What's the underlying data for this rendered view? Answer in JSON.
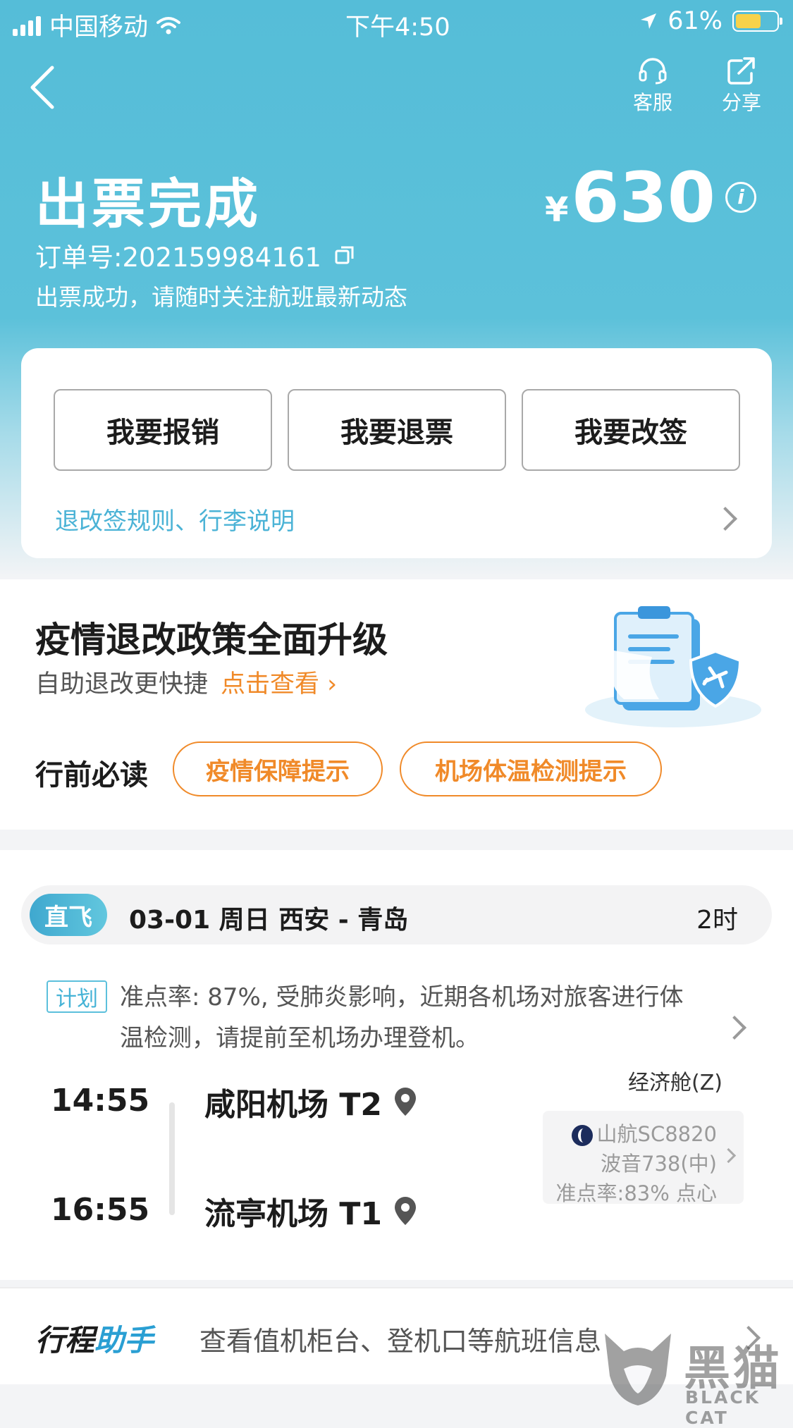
{
  "status_bar": {
    "carrier": "中国移动",
    "time": "下午4:50",
    "battery": "61%",
    "battery_level": 0.61
  },
  "nav": {
    "service_label": "客服",
    "share_label": "分享"
  },
  "header": {
    "title": "出票完成",
    "currency": "¥",
    "price": "630",
    "order_number": "订单号:202159984161",
    "message": "出票成功，请随时关注航班最新动态"
  },
  "actions": {
    "reimburse": "我要报销",
    "refund": "我要退票",
    "change": "我要改签",
    "rules_link": "退改签规则、行李说明"
  },
  "policy": {
    "title": "疫情退改政策全面升级",
    "subtitle": "自助退改更快捷",
    "link": "点击查看 ›",
    "must_read": "行前必读",
    "pill_1": "疫情保障提示",
    "pill_2": "机场体温检测提示"
  },
  "flight": {
    "tag": "直飞",
    "route": "03-01  周日  西安 - 青岛",
    "duration": "2时",
    "plan_tag": "计划",
    "notice": "准点率: 87%, 受肺炎影响，近期各机场对旅客进行体温检测，请提前至机场办理登机。",
    "departure_time": "14:55",
    "departure_airport": "咸阳机场 T2",
    "arrival_time": "16:55",
    "arrival_airport": "流亭机场 T1",
    "cabin": "经济舱(Z)",
    "flight_no": "山航SC8820",
    "aircraft": "波音738(中)",
    "punctuality": "准点率:83% 点心"
  },
  "assistant": {
    "logo_part1": "行程",
    "logo_part2": "助手",
    "text": "查看值机柜台、登机口等航班信息"
  },
  "watermark": {
    "cn": "黑猫",
    "en": "BLACK CAT"
  },
  "colors": {
    "header_blue": "#55bdd8",
    "accent_orange": "#f08a29",
    "link_blue": "#4bb3d6"
  }
}
